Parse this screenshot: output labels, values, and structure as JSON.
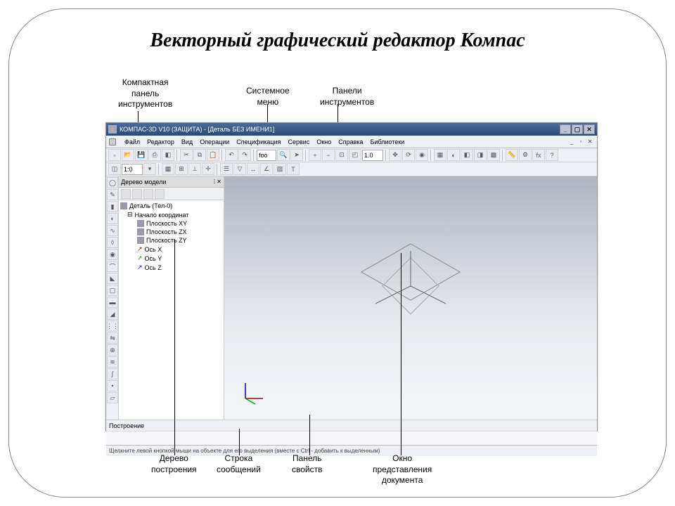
{
  "slide_title": "Векторный графический редактор Компас",
  "callouts_top": {
    "compact_panel": "Компактная\nпанель\nинструментов",
    "system_menu": "Системное\nменю",
    "tool_panels": "Панели\nинструментов"
  },
  "callouts_bottom": {
    "build_tree": "Дерево\nпостроения",
    "msg_row": "Строка\nсообщений",
    "prop_panel": "Панель\nсвойств",
    "view_window": "Окно\nпредставления\nдокумента"
  },
  "app": {
    "title": "КОМПАС-3D V10 (ЗАЩИТА) - [Деталь БЕЗ ИМЕНИ1]",
    "menu": [
      "Файл",
      "Редактор",
      "Вид",
      "Операции",
      "Спецификация",
      "Сервис",
      "Окно",
      "Справка",
      "Библиотеки"
    ],
    "zoom": "1.0",
    "scale": "1:0",
    "tree_title": "Дерево модели",
    "tree_close": "✕",
    "tree_root": "Деталь (Тел-0)",
    "tree_origin": "Начало координат",
    "tree_items": [
      "Плоскость XY",
      "Плоскость ZX",
      "Плоскость ZY",
      "Ось X",
      "Ось Y",
      "Ось Z"
    ],
    "proppanel_label": "Построение",
    "status": "Щелкните левой кнопкой мыши на объекте для его выделения (вместе с Ctrl - добавить к выделенным)"
  }
}
